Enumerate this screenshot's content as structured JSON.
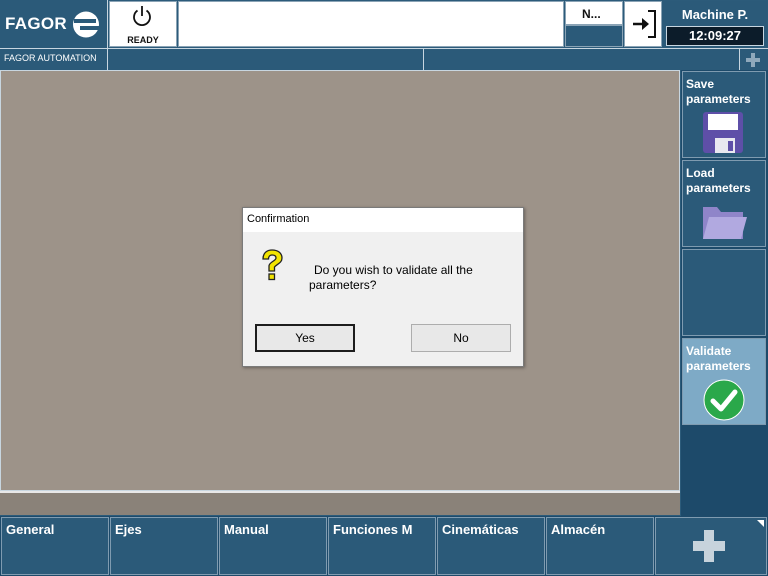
{
  "header": {
    "brand": "FAGOR",
    "brand_sub": "FAGOR AUTOMATION",
    "status": "READY",
    "mode_short": "N...",
    "mode_title": "Machine P.",
    "clock": "12:09:27"
  },
  "side_softkeys": [
    {
      "label": "Save parameters",
      "icon": "floppy-disk-icon",
      "active": false
    },
    {
      "label": "Load parameters",
      "icon": "folder-icon",
      "active": false
    },
    {
      "label": "",
      "icon": "",
      "active": false
    },
    {
      "label": "Validate parameters",
      "icon": "check-icon",
      "active": true
    }
  ],
  "bottom_softkeys": [
    {
      "label": "General"
    },
    {
      "label": "Ejes"
    },
    {
      "label": "Manual"
    },
    {
      "label": "Funciones M"
    },
    {
      "label": "Cinemáticas"
    },
    {
      "label": "Almacén"
    },
    {
      "label": "",
      "icon": "plus-icon"
    }
  ],
  "dialog": {
    "title": "Confirmation",
    "message": "Do you wish to validate all the parameters?",
    "yes_label": "Yes",
    "no_label": "No",
    "icon": "question-icon"
  },
  "colors": {
    "panel": "#2b5a79",
    "active_key": "#7eaac6",
    "work_area": "#9d9389",
    "check_green": "#2aa84a"
  }
}
